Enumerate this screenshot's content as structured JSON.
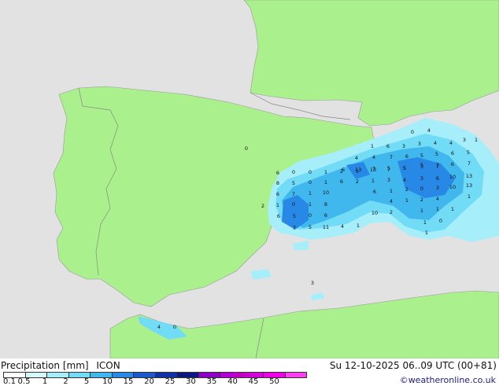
{
  "map": {
    "land_color": "#aaf08c",
    "sea_color": "#e2e2e2",
    "precip_values": [
      "0",
      "4",
      "3",
      "1",
      "1",
      "6",
      "3",
      "3",
      "4",
      "4",
      "4",
      "4",
      "7",
      "6",
      "5",
      "5",
      "6",
      "5",
      "0",
      "6",
      "5",
      "13",
      "7",
      "5",
      "5",
      "7",
      "6",
      "7",
      "6",
      "0",
      "0",
      "1",
      "2",
      "5",
      "13",
      "7",
      "5",
      "3",
      "7",
      "8",
      "5",
      "0",
      "1",
      "6",
      "2",
      "1",
      "3",
      "4",
      "3",
      "6",
      "10",
      "13",
      "6",
      "7",
      "1",
      "10",
      "6",
      "1",
      "2",
      "0",
      "3",
      "10",
      "13",
      "2",
      "1",
      "0",
      "1",
      "8",
      "4",
      "1",
      "2",
      "4",
      "1",
      "6",
      "5",
      "0",
      "6",
      "10",
      "2",
      "1",
      "1",
      "1",
      "7",
      "5",
      "11",
      "4",
      "1",
      "1",
      "0",
      "3",
      "4",
      "0",
      "1",
      "1",
      "1"
    ]
  },
  "legend": {
    "title": "Precipitation [mm]",
    "model": "ICON",
    "datetime": "Su 12-10-2025 06..09 UTC (00+81)",
    "credit": "©weatheronline.co.uk",
    "scale": [
      {
        "label": "0.1",
        "color": "#ffffff"
      },
      {
        "label": "0.5",
        "color": "#d6f8fc"
      },
      {
        "label": "1",
        "color": "#a6eefa"
      },
      {
        "label": "2",
        "color": "#72dcf6"
      },
      {
        "label": "5",
        "color": "#40b8ee"
      },
      {
        "label": "10",
        "color": "#2888e6"
      },
      {
        "label": "15",
        "color": "#1a58cc"
      },
      {
        "label": "20",
        "color": "#1030a8"
      },
      {
        "label": "25",
        "color": "#0a1880"
      },
      {
        "label": "30",
        "color": "#8c00c8"
      },
      {
        "label": "35",
        "color": "#b400d8"
      },
      {
        "label": "40",
        "color": "#d800e0"
      },
      {
        "label": "45",
        "color": "#f000e6"
      },
      {
        "label": "50",
        "color": "#ff40f0"
      }
    ]
  }
}
